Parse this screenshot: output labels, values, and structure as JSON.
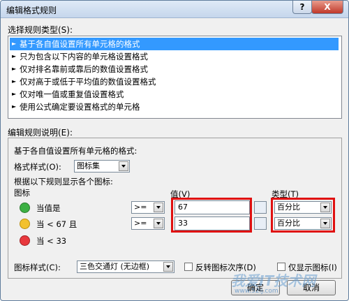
{
  "window": {
    "title": "编辑格式规则",
    "help_label": "?",
    "close_label": "X"
  },
  "rule_type": {
    "heading": "选择规则类型(S):",
    "items": [
      "基于各自值设置所有单元格的格式",
      "只为包含以下内容的单元格设置格式",
      "仅对排名靠前或靠后的数值设置格式",
      "仅对高于或低于平均值的数值设置格式",
      "仅对唯一值或重复值设置格式",
      "使用公式确定要设置格式的单元格"
    ],
    "selected_index": 0
  },
  "rule_desc": {
    "heading": "编辑规则说明(E):",
    "subheading": "基于各自值设置所有单元格的格式:",
    "format_style_label": "格式样式(O):",
    "format_style_value": "图标集",
    "show_each_icon_label": "根据以下规则显示各个图标:",
    "icon_col": "图标",
    "value_col": "值(V)",
    "type_col": "类型(T)",
    "rows": [
      {
        "desc": "当值是",
        "op": ">=",
        "value": "67",
        "type": "百分比",
        "color": "#3cb043"
      },
      {
        "desc": "当 < 67 且",
        "op": ">=",
        "value": "33",
        "type": "百分比",
        "color": "#f2c12e"
      },
      {
        "desc": "当 < 33",
        "color": "#e8383d"
      }
    ],
    "icon_style_label": "图标样式(C):",
    "icon_style_value": "三色交通灯 (无边框)",
    "reverse_label": "反转图标次序(D)",
    "show_icon_only_label": "仅显示图标(I)"
  },
  "buttons": {
    "ok": "确定",
    "cancel": "取消"
  },
  "watermark": {
    "main": "我爱IT技术网",
    "sub": "www.52ij.com"
  }
}
